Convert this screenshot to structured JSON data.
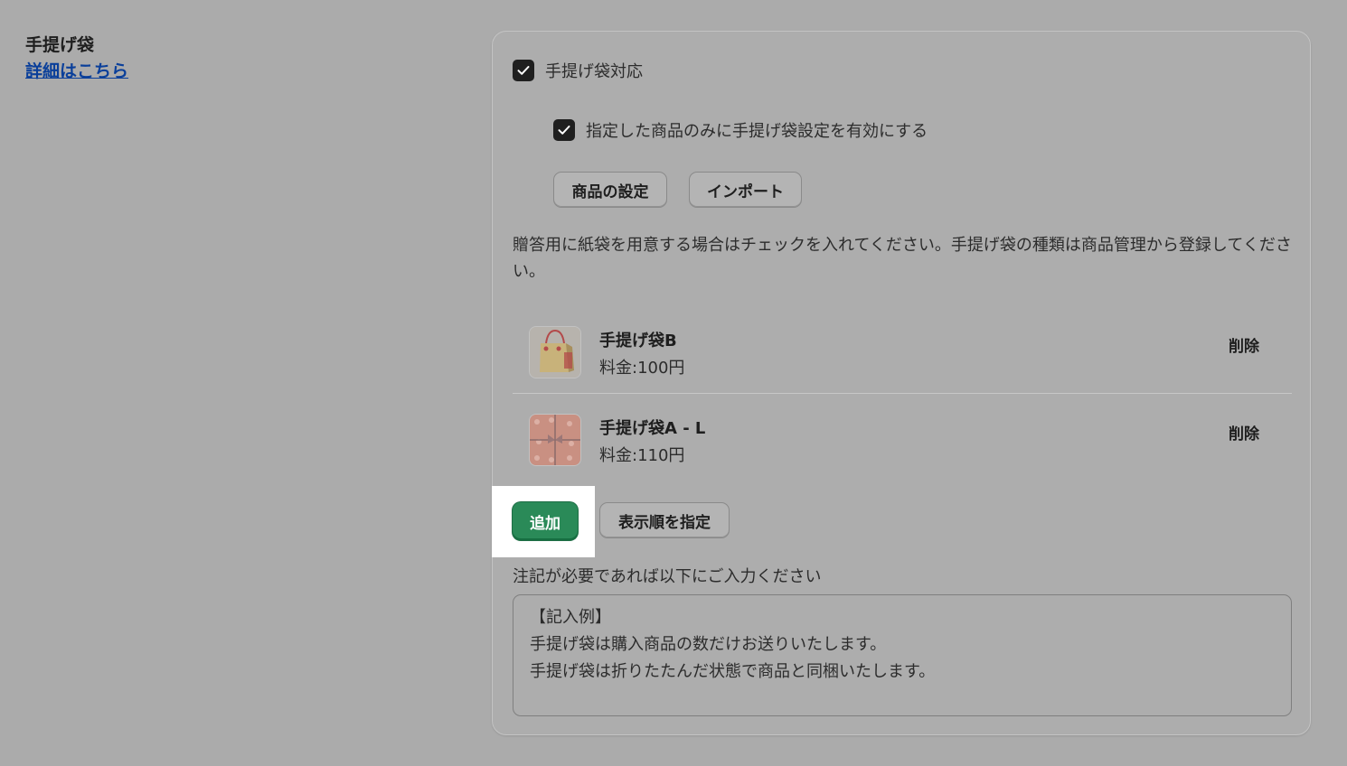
{
  "section": {
    "title": "手提げ袋",
    "help_link": "詳細はこちら"
  },
  "options": {
    "enable_label": "手提げ袋対応",
    "enable_checked": true,
    "limit_label": "指定した商品のみに手提げ袋設定を有効にする",
    "limit_checked": true,
    "product_settings_button": "商品の設定",
    "import_button": "インポート"
  },
  "description": "贈答用に紙袋を用意する場合はチェックを入れてください。手提げ袋の種類は商品管理から登録してください。",
  "items": [
    {
      "name": "手提げ袋B",
      "price": "料金:100円",
      "delete": "削除",
      "thumbnail": "paper-bag-image"
    },
    {
      "name": "手提げ袋A - L",
      "price": "料金:110円",
      "delete": "削除",
      "thumbnail": "gift-box-image"
    }
  ],
  "actions": {
    "add_button": "追加",
    "order_button": "表示順を指定"
  },
  "note": {
    "label": "注記が必要であれば以下にご入力ください",
    "lines": [
      "【記入例】",
      "手提げ袋は購入商品の数だけお送りいたします。",
      "手提げ袋は折りたたんだ状態で商品と同梱いたします。"
    ]
  },
  "colors": {
    "background": "#ababab",
    "primary": "#2a8a58",
    "link": "#0a3f9a",
    "highlight": "#ffffff"
  }
}
